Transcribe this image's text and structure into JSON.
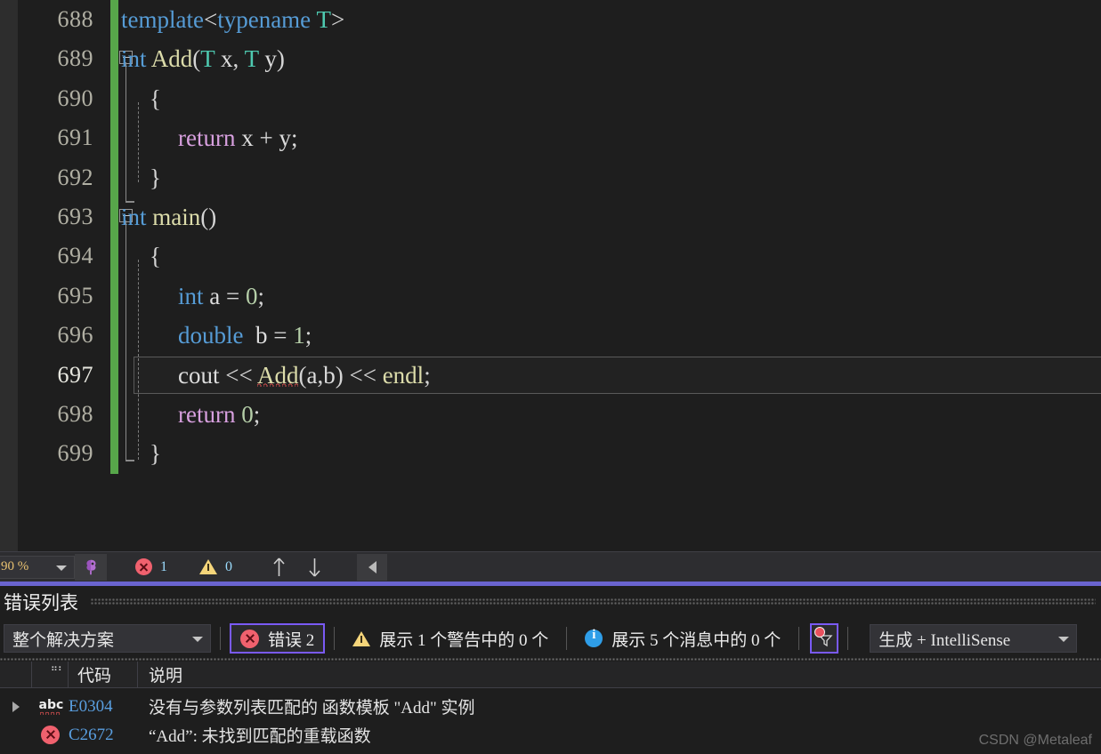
{
  "editor": {
    "lines": [
      {
        "number": "688",
        "indent": 0,
        "tokens": [
          {
            "t": "template",
            "c": "kw"
          },
          {
            "t": "<",
            "c": "pun"
          },
          {
            "t": "typename",
            "c": "kw"
          },
          {
            "t": " ",
            "c": "pl"
          },
          {
            "t": "T",
            "c": "typ"
          },
          {
            "t": ">",
            "c": "pun"
          }
        ]
      },
      {
        "number": "689",
        "indent": 0,
        "fold": true,
        "tokens": [
          {
            "t": "int",
            "c": "kw"
          },
          {
            "t": " ",
            "c": "pl"
          },
          {
            "t": "Add",
            "c": "fn"
          },
          {
            "t": "(",
            "c": "pun"
          },
          {
            "t": "T",
            "c": "typ"
          },
          {
            "t": " x",
            "c": "pl"
          },
          {
            "t": ", ",
            "c": "pun"
          },
          {
            "t": "T",
            "c": "typ"
          },
          {
            "t": " y",
            "c": "pl"
          },
          {
            "t": ")",
            "c": "pun"
          }
        ]
      },
      {
        "number": "690",
        "indent": 1,
        "tokens": [
          {
            "t": "{",
            "c": "pun"
          }
        ]
      },
      {
        "number": "691",
        "indent": 2,
        "tokens": [
          {
            "t": "return",
            "c": "kw2"
          },
          {
            "t": " x ",
            "c": "pl"
          },
          {
            "t": "+",
            "c": "pun"
          },
          {
            "t": " y;",
            "c": "pl"
          }
        ]
      },
      {
        "number": "692",
        "indent": 1,
        "tokens": [
          {
            "t": "}",
            "c": "pun"
          }
        ]
      },
      {
        "number": "693",
        "indent": 0,
        "fold": true,
        "tokens": [
          {
            "t": "int",
            "c": "kw"
          },
          {
            "t": " ",
            "c": "pl"
          },
          {
            "t": "main",
            "c": "fn"
          },
          {
            "t": "()",
            "c": "pun"
          }
        ]
      },
      {
        "number": "694",
        "indent": 1,
        "tokens": [
          {
            "t": "{",
            "c": "pun"
          }
        ]
      },
      {
        "number": "695",
        "indent": 2,
        "tokens": [
          {
            "t": "int",
            "c": "kw"
          },
          {
            "t": " a ",
            "c": "pl"
          },
          {
            "t": "=",
            "c": "pun"
          },
          {
            "t": " ",
            "c": "pl"
          },
          {
            "t": "0",
            "c": "num"
          },
          {
            "t": ";",
            "c": "pun"
          }
        ]
      },
      {
        "number": "696",
        "indent": 2,
        "tokens": [
          {
            "t": "double",
            "c": "kw"
          },
          {
            "t": "  b ",
            "c": "pl"
          },
          {
            "t": "=",
            "c": "pun"
          },
          {
            "t": " ",
            "c": "pl"
          },
          {
            "t": "1",
            "c": "num"
          },
          {
            "t": ";",
            "c": "pun"
          }
        ]
      },
      {
        "number": "697",
        "current": true,
        "indent": 2,
        "tokens": [
          {
            "t": "cout ",
            "c": "pl"
          },
          {
            "t": "<<",
            "c": "pun"
          },
          {
            "t": " ",
            "c": "pl"
          },
          {
            "t": "Add",
            "c": "fn",
            "squiggle": true
          },
          {
            "t": "(",
            "c": "pun"
          },
          {
            "t": "a",
            "c": "pl"
          },
          {
            "t": ",",
            "c": "pun"
          },
          {
            "t": "b",
            "c": "pl"
          },
          {
            "t": ")",
            "c": "pun"
          },
          {
            "t": " ",
            "c": "pl"
          },
          {
            "t": "<<",
            "c": "pun"
          },
          {
            "t": " ",
            "c": "pl"
          },
          {
            "t": "endl",
            "c": "fn"
          },
          {
            "t": ";",
            "c": "pun"
          }
        ]
      },
      {
        "number": "698",
        "indent": 2,
        "tokens": [
          {
            "t": "return",
            "c": "kw2"
          },
          {
            "t": " ",
            "c": "pl"
          },
          {
            "t": "0",
            "c": "num"
          },
          {
            "t": ";",
            "c": "pun"
          }
        ]
      },
      {
        "number": "699",
        "indent": 1,
        "tokens": [
          {
            "t": "}",
            "c": "pun"
          }
        ]
      }
    ]
  },
  "statusbar": {
    "zoom_value": "90 %",
    "intellisense_icon": "brain-icon",
    "error_count": "1",
    "warning_count": "0",
    "nav_up_icon": "arrow-up-icon",
    "nav_down_icon": "arrow-down-icon",
    "nav_prev_icon": "triangle-left-icon"
  },
  "error_panel": {
    "title": "错误列表",
    "scope_value": "整个解决方案",
    "errors_filter": "错误 2",
    "warnings_filter": "展示 1 个警告中的 0 个",
    "messages_filter": "展示 5 个消息中的 0 个",
    "funnel_icon": "filter-funnel-icon",
    "build_value": "生成 + IntelliSense",
    "columns": [
      "",
      "",
      "代码",
      "说明"
    ],
    "rows": [
      {
        "expander": "expand-triangle-icon",
        "icon": "abc-squiggle-icon",
        "code": "E0304",
        "description": "没有与参数列表匹配的 函数模板 \"Add\" 实例"
      },
      {
        "expander": "",
        "icon": "error-circle-icon",
        "code": "C2672",
        "description": "“Add”: 未找到匹配的重载函数"
      }
    ]
  },
  "watermark": "CSDN @Metaleaf",
  "colors": {
    "accent_purple": "#6a64cf",
    "filter_highlight": "#7a5af5",
    "saved_bar_green": "#57a64a",
    "error_red": "#f0616e",
    "warning_yellow": "#f5d57a",
    "info_blue": "#2f9ee8",
    "editor_bg": "#1e1e1e",
    "code_link_blue": "#5a9fe0"
  }
}
